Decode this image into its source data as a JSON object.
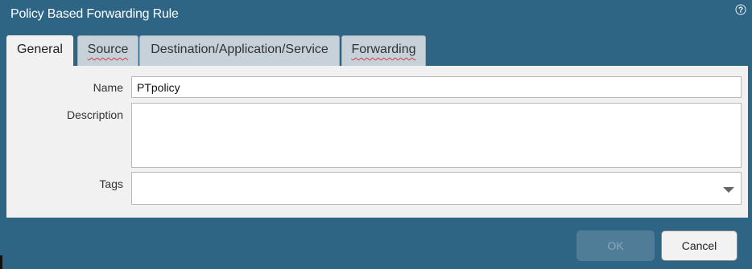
{
  "dialog": {
    "title": "Policy Based Forwarding Rule",
    "help_icon": "help-circle-icon"
  },
  "tabs": [
    {
      "label": "General",
      "active": true
    },
    {
      "label": "Source",
      "active": false,
      "error": true
    },
    {
      "label": "Destination/Application/Service",
      "active": false,
      "error": false
    },
    {
      "label": "Forwarding",
      "active": false,
      "error": true
    }
  ],
  "form": {
    "name_label": "Name",
    "name_value": "PTpolicy",
    "description_label": "Description",
    "description_value": "",
    "tags_label": "Tags",
    "tags_value": ""
  },
  "buttons": {
    "ok_label": "OK",
    "cancel_label": "Cancel"
  },
  "colors": {
    "dialog_bg": "#2e6585",
    "panel_bg": "#f1f1f1",
    "tab_bg": "#c6d1d9",
    "error_underline": "#d63c3c"
  }
}
